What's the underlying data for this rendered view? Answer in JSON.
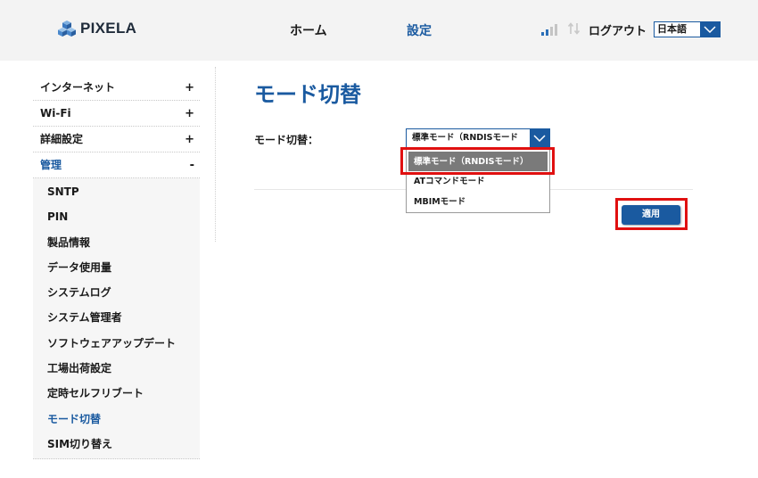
{
  "header": {
    "logo_text": "PIXELA",
    "nav": {
      "home": "ホーム",
      "settings": "設定"
    },
    "logout": "ログアウト",
    "language": {
      "selected": "日本語"
    }
  },
  "sidebar": {
    "sections": [
      {
        "label": "インターネット",
        "toggle": "+"
      },
      {
        "label": "Wi-Fi",
        "toggle": "+"
      },
      {
        "label": "詳細設定",
        "toggle": "+"
      },
      {
        "label": "管理",
        "toggle": "-"
      }
    ],
    "sub_items": [
      "SNTP",
      "PIN",
      "製品情報",
      "データ使用量",
      "システムログ",
      "システム管理者",
      "ソフトウェアアップデート",
      "工場出荷設定",
      "定時セルフリブート",
      "モード切替",
      "SIM切り替え"
    ]
  },
  "main": {
    "title": "モード切替",
    "mode_label": "モード切替：",
    "mode_select": {
      "value": "標準モード（RNDISモード",
      "options": [
        "標準モード（RNDISモード）",
        "ATコマンドモード",
        "MBIMモード"
      ]
    },
    "apply": "適用"
  },
  "colors": {
    "accent": "#1a5aa0",
    "highlight": "#e01010",
    "header_bg": "#f3f3f3"
  }
}
